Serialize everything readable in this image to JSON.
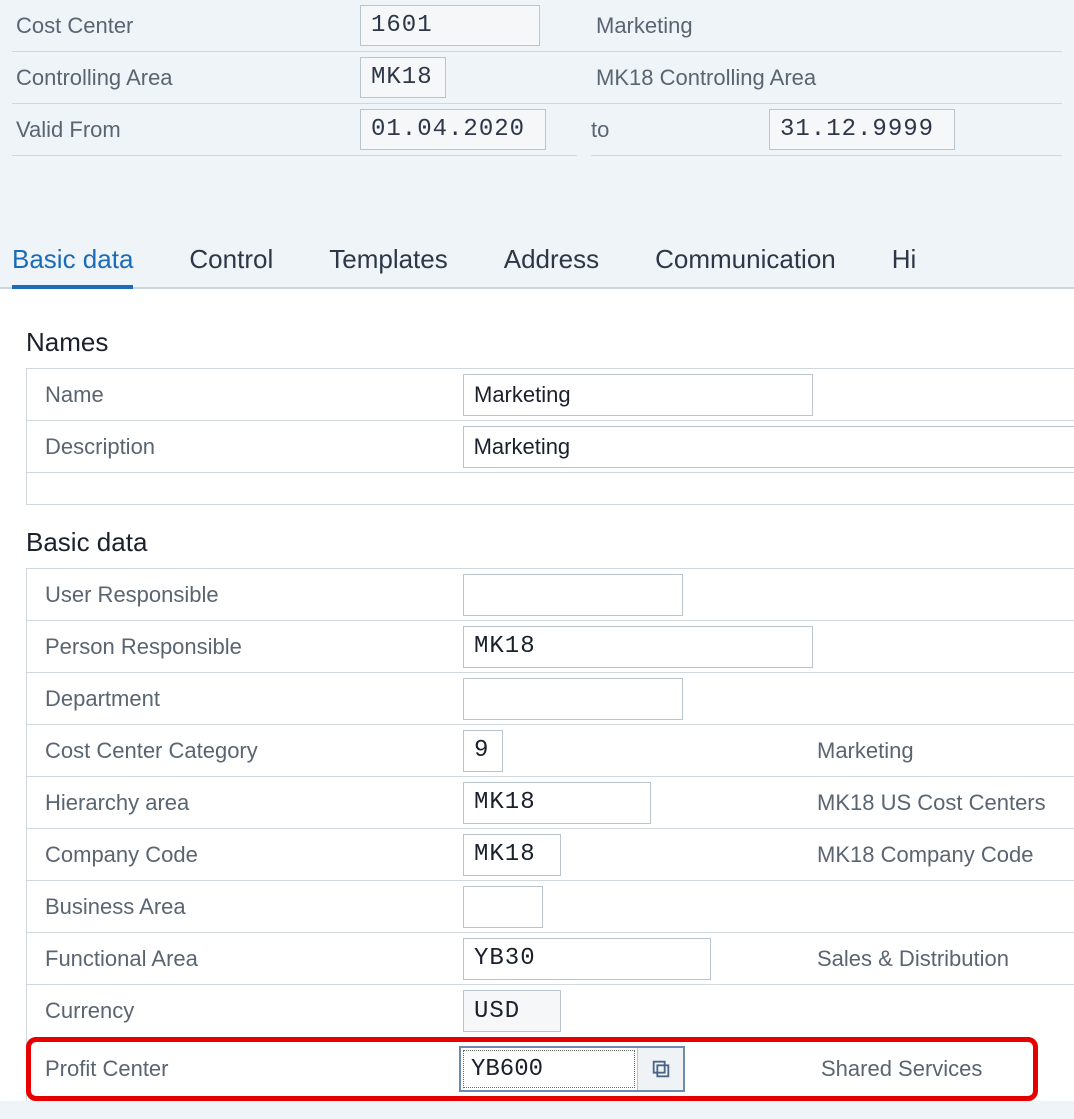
{
  "header": {
    "costCenter": {
      "label": "Cost Center",
      "value": "1601",
      "desc": "Marketing"
    },
    "controllingArea": {
      "label": "Controlling Area",
      "value": "MK18",
      "desc": "MK18 Controlling Area"
    },
    "validFrom": {
      "label": "Valid From",
      "value": "01.04.2020"
    },
    "validTo": {
      "label": "to",
      "value": "31.12.9999"
    }
  },
  "tabs": {
    "basicData": "Basic data",
    "control": "Control",
    "templates": "Templates",
    "address": "Address",
    "communication": "Communication",
    "history": "Hi"
  },
  "names": {
    "title": "Names",
    "name": {
      "label": "Name",
      "value": "Marketing"
    },
    "description": {
      "label": "Description",
      "value": "Marketing"
    }
  },
  "basic": {
    "title": "Basic data",
    "userResponsible": {
      "label": "User Responsible",
      "value": ""
    },
    "personResponsible": {
      "label": "Person Responsible",
      "value": "MK18"
    },
    "department": {
      "label": "Department",
      "value": ""
    },
    "category": {
      "label": "Cost Center Category",
      "value": "9",
      "desc": "Marketing"
    },
    "hierarchy": {
      "label": "Hierarchy area",
      "value": "MK18",
      "desc": "MK18 US Cost Centers"
    },
    "companyCode": {
      "label": "Company Code",
      "value": "MK18",
      "desc": "MK18 Company Code"
    },
    "businessArea": {
      "label": "Business Area",
      "value": ""
    },
    "functionalArea": {
      "label": "Functional Area",
      "value": "YB30",
      "desc": "Sales & Distribution"
    },
    "currency": {
      "label": "Currency",
      "value": "USD"
    },
    "profitCenter": {
      "label": "Profit Center",
      "value": "YB600",
      "desc": "Shared Services"
    }
  }
}
